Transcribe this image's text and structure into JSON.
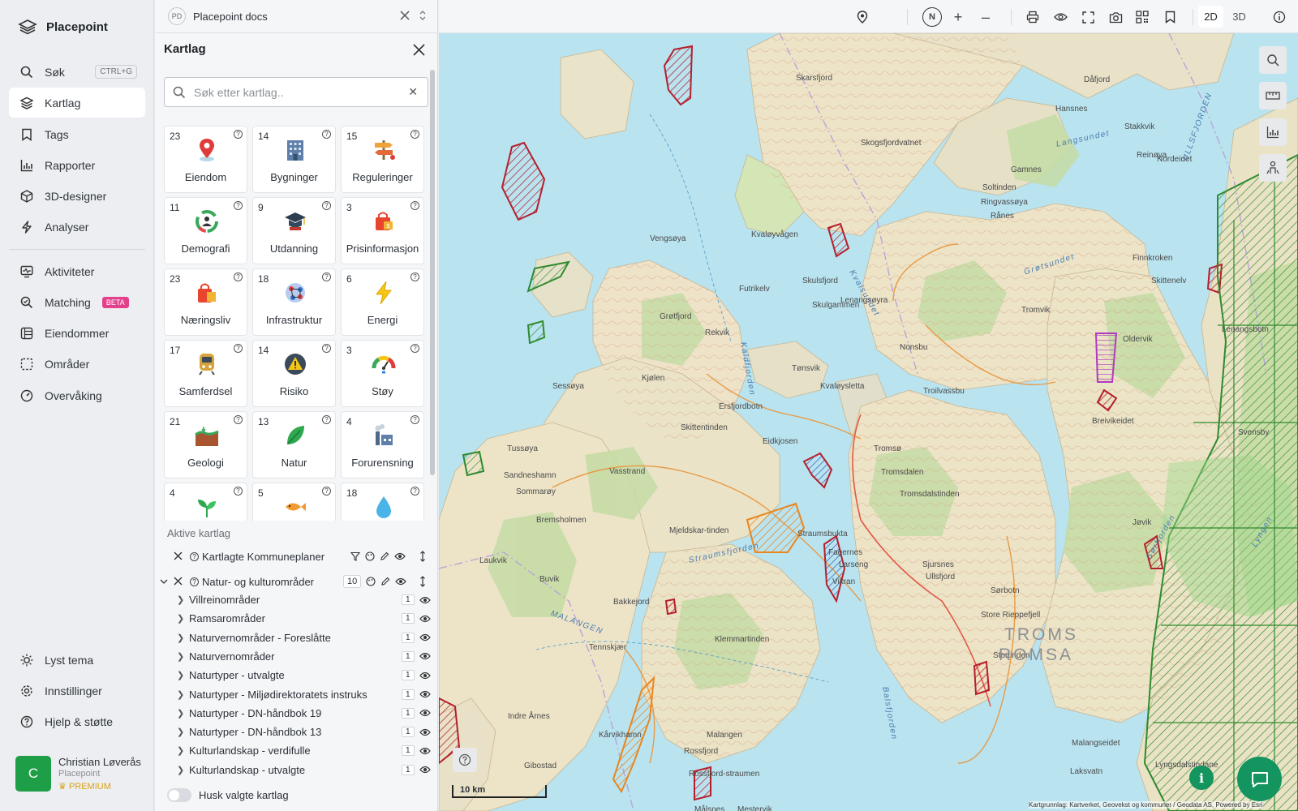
{
  "app": {
    "name": "Placepoint"
  },
  "sidebar": {
    "items": [
      {
        "label": "Søk",
        "shortcut": "CTRL+G"
      },
      {
        "label": "Kartlag"
      },
      {
        "label": "Tags"
      },
      {
        "label": "Rapporter"
      },
      {
        "label": "3D-designer"
      },
      {
        "label": "Analyser"
      },
      {
        "label": "Aktiviteter"
      },
      {
        "label": "Matching",
        "badge": "BETA"
      },
      {
        "label": "Eiendommer"
      },
      {
        "label": "Områder"
      },
      {
        "label": "Overvåking"
      }
    ],
    "bottom": [
      {
        "label": "Lyst tema"
      },
      {
        "label": "Innstillinger"
      },
      {
        "label": "Hjelp & støtte"
      }
    ],
    "user": {
      "initial": "C",
      "name": "Christian Løverås",
      "org": "Placepoint",
      "plan": "PREMIUM"
    }
  },
  "doc": {
    "badge": "PD",
    "title": "Placepoint docs"
  },
  "panel": {
    "title": "Kartlag",
    "search_placeholder": "Søk etter kartlag..",
    "categories": [
      {
        "count": "23",
        "label": "Eiendom"
      },
      {
        "count": "14",
        "label": "Bygninger"
      },
      {
        "count": "15",
        "label": "Reguleringer"
      },
      {
        "count": "11",
        "label": "Demografi"
      },
      {
        "count": "9",
        "label": "Utdanning"
      },
      {
        "count": "3",
        "label": "Prisinformasjon"
      },
      {
        "count": "23",
        "label": "Næringsliv"
      },
      {
        "count": "18",
        "label": "Infrastruktur"
      },
      {
        "count": "6",
        "label": "Energi"
      },
      {
        "count": "17",
        "label": "Samferdsel"
      },
      {
        "count": "14",
        "label": "Risiko"
      },
      {
        "count": "3",
        "label": "Støy"
      },
      {
        "count": "21",
        "label": "Geologi"
      },
      {
        "count": "13",
        "label": "Natur"
      },
      {
        "count": "4",
        "label": "Forurensning"
      },
      {
        "count": "4",
        "label": ""
      },
      {
        "count": "5",
        "label": ""
      },
      {
        "count": "18",
        "label": ""
      }
    ],
    "active_header": "Aktive kartlag",
    "active_groups": [
      {
        "name": "Kartlagte Kommuneplaner"
      },
      {
        "name": "Natur- og kulturområder",
        "count": "10"
      }
    ],
    "sublayers": [
      {
        "name": "Villreinområder",
        "count": "1"
      },
      {
        "name": "Ramsarområder",
        "count": "1"
      },
      {
        "name": "Naturvernområder - Foreslåtte",
        "count": "1"
      },
      {
        "name": "Naturvernområder",
        "count": "1"
      },
      {
        "name": "Naturtyper - utvalgte",
        "count": "1"
      },
      {
        "name": "Naturtyper - Miljødirektoratets instruks",
        "count": "1"
      },
      {
        "name": "Naturtyper - DN-håndbok 19",
        "count": "1"
      },
      {
        "name": "Naturtyper - DN-håndbok 13",
        "count": "1"
      },
      {
        "name": "Kulturlandskap - verdifulle",
        "count": "1"
      },
      {
        "name": "Kulturlandskap - utvalgte",
        "count": "1"
      }
    ],
    "remember_label": "Husk valgte kartlag"
  },
  "toolbar": {
    "north": "N",
    "view_2d": "2D",
    "view_3d": "3D"
  },
  "map": {
    "places": [
      "Skarsfjord",
      "Dåfjord",
      "Hansnes",
      "Skogsfjordvatnet",
      "Stakkvik",
      "Reinøya",
      "Nordeidet",
      "Gamnes",
      "Soltinden",
      "Ringvassøya",
      "Rånes",
      "Vengsøya",
      "Kvaløyvågen",
      "Finnkroken",
      "Skulsfjord",
      "Futrikelv",
      "Skulgammen",
      "Lenangsøyra",
      "Skittenelv",
      "Tromvik",
      "Grøtfjord",
      "Rekvik",
      "Kjølen",
      "Tønsvik",
      "Nonsbu",
      "Troilvassbu",
      "Oldervik",
      "Sessøya",
      "Ersfjordbotn",
      "Kvaløysletta",
      "Breivikeidet",
      "Tussøya",
      "Skittentinden",
      "Eidkjosen",
      "Tromsø",
      "Tromsdalen",
      "Tromsdalstinden",
      "Sandneshamn",
      "Vasstrand",
      "Sommarøy",
      "Bremsholmen",
      "Mjeldskar-tinden",
      "Straumsbukta",
      "Larseng",
      "Fagernes",
      "Sjursnes",
      "Ullsfjord",
      "Jøvik",
      "Laukvik",
      "Buvik",
      "Bakkejord",
      "Vikran",
      "Sørbotn",
      "Store Rieppefjell",
      "Tennskjær",
      "Klemmartinden",
      "Stortinden",
      "Indre Årnes",
      "Kårvikhamn",
      "Malangen",
      "Malangseidet",
      "Gibostad",
      "Rossfjord",
      "Rossfjord-straumen",
      "Laksvatn",
      "Lyngsdalstindane",
      "Mestervik",
      "Målsnes",
      "Balsfjord",
      "Lenangsbotn",
      "Svensby"
    ],
    "water_labels": [
      "MALANGEN",
      "Straumsfjorden",
      "Kaldfjorden",
      "Grøtsundet",
      "Langsundet",
      "ULLSFJORDEN",
      "Kvalsundet",
      "Balsfjorden",
      "Sørfjorden",
      "Lyngen"
    ],
    "region_label_1": "TROMS",
    "region_label_2": "ROMSA",
    "scale_label": "10 km",
    "attribution": "Kartgrunnlag: Kartverket, Geovekst og kommuner / Geodata AS, Powered by Esri",
    "colors": {
      "water": "#b9e3ef",
      "land": "#eee3c8",
      "forest": "#c4dca4",
      "red_zone": "#b51f2c",
      "green_zone": "#2f8a2f",
      "orange_zone": "#e8861f",
      "blue_zone": "#2b4fb5"
    }
  }
}
